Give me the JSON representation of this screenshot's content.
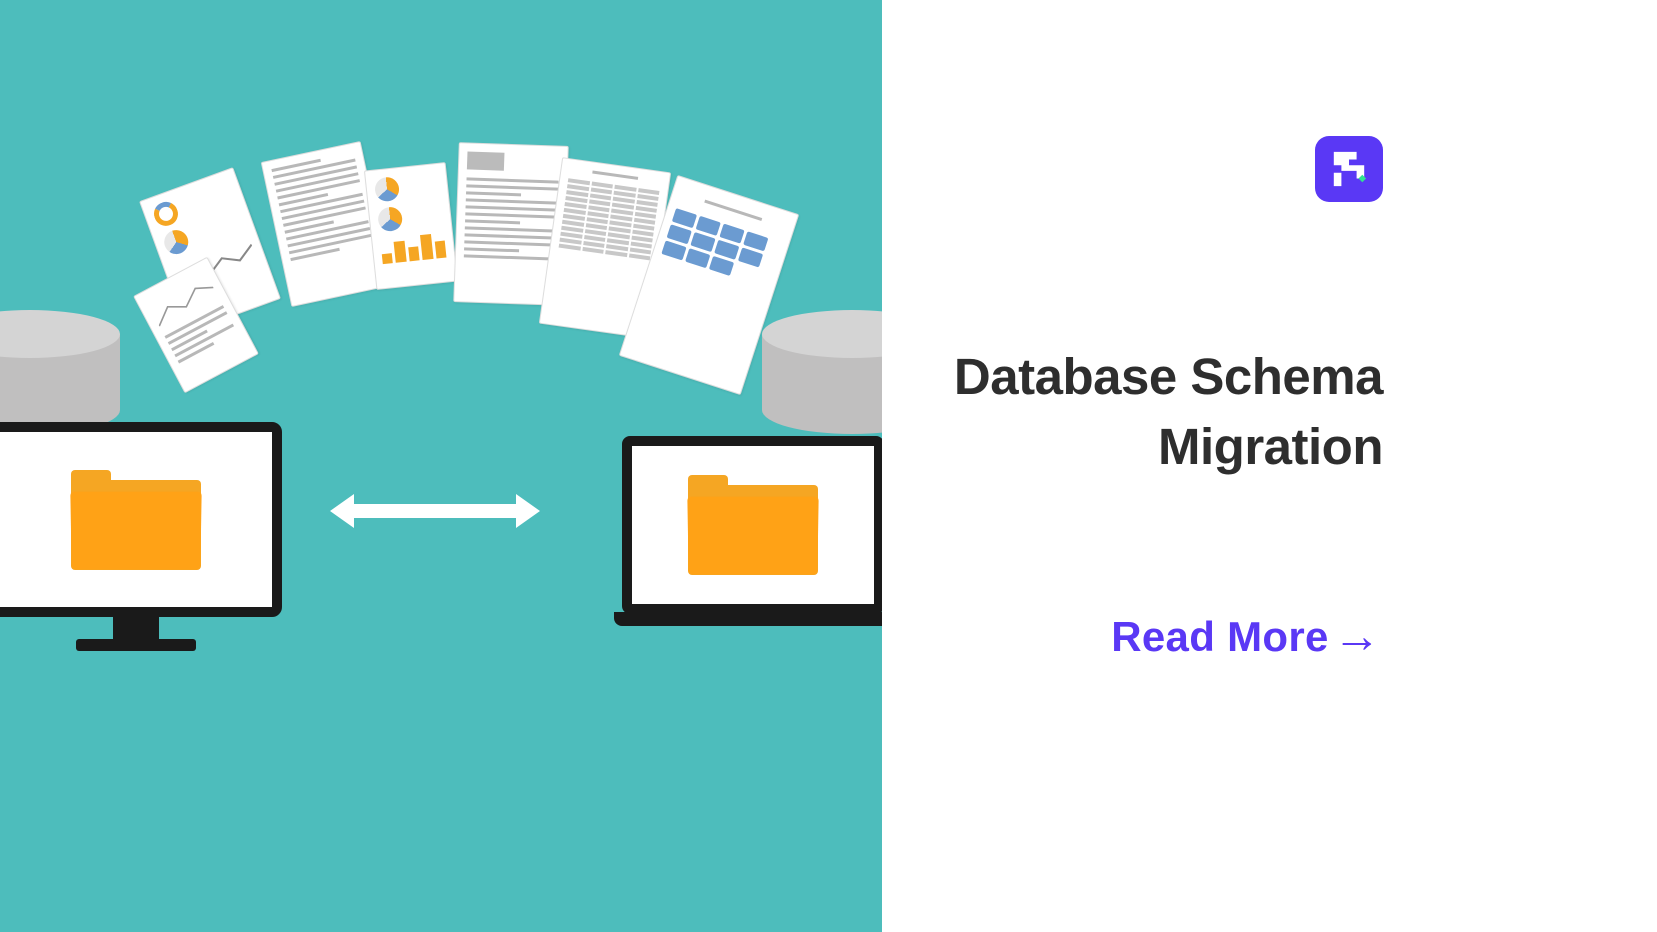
{
  "title": "Database Schema Migration",
  "cta": {
    "label": "Read More",
    "arrow": "→"
  },
  "brand": {
    "logo_bg": "#5a38f5",
    "accent": "#30e391"
  },
  "colors": {
    "illustration_bg": "#4dbdbc",
    "folder": "#f5a623",
    "heading": "#2e2e2e",
    "link": "#5a38f5"
  }
}
